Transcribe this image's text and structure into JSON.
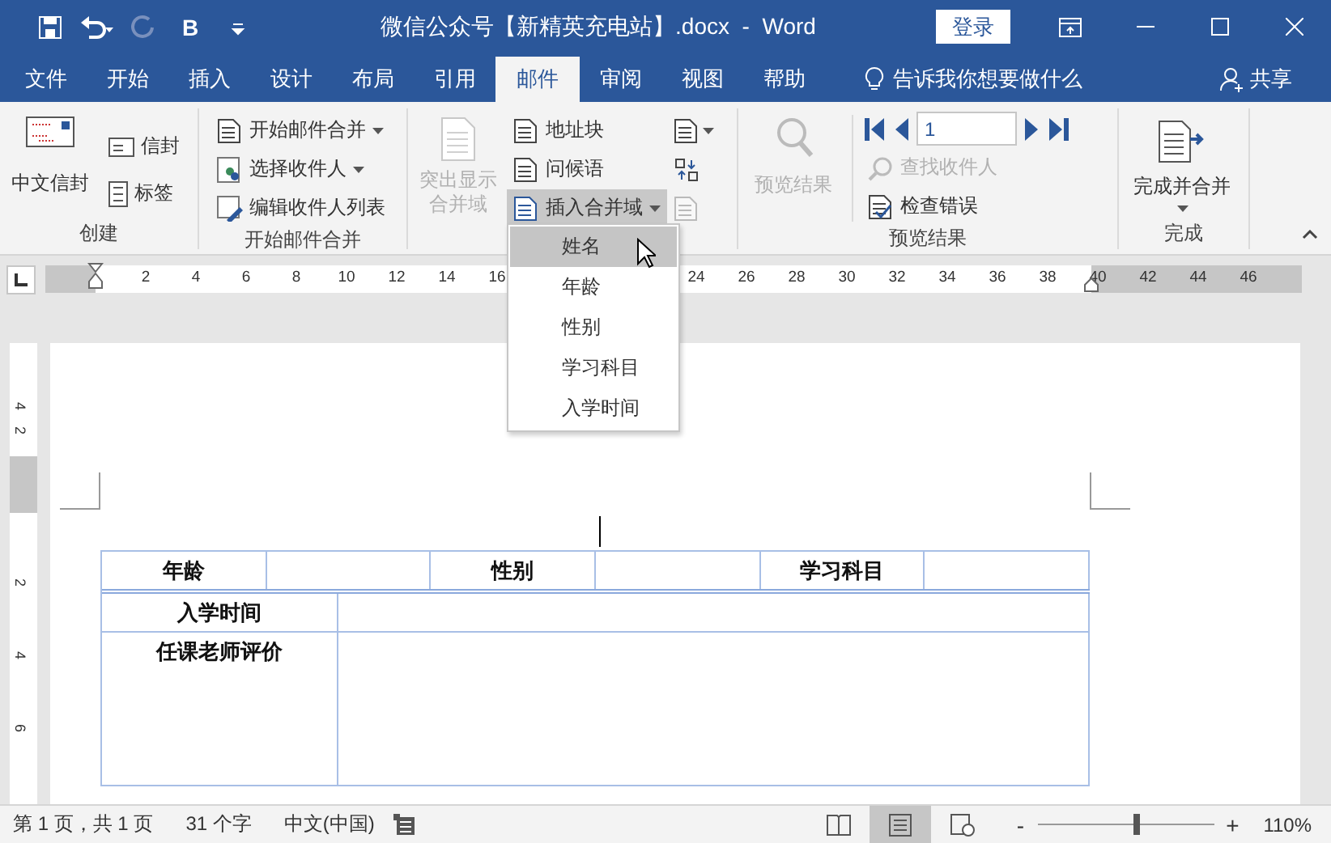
{
  "window": {
    "title": "微信公众号【新精英充电站】.docx  -  Word",
    "login_button": "登录"
  },
  "quick_access": {
    "bold_label": "B",
    "redo_disabled": true
  },
  "tabs": [
    {
      "label": "文件",
      "selected": false
    },
    {
      "label": "开始",
      "selected": false
    },
    {
      "label": "插入",
      "selected": false
    },
    {
      "label": "设计",
      "selected": false
    },
    {
      "label": "布局",
      "selected": false
    },
    {
      "label": "引用",
      "selected": false
    },
    {
      "label": "邮件",
      "selected": true
    },
    {
      "label": "审阅",
      "selected": false
    },
    {
      "label": "视图",
      "selected": false
    },
    {
      "label": "帮助",
      "selected": false
    }
  ],
  "tell_me": "告诉我你想要做什么",
  "share": "共享",
  "ribbon": {
    "create": {
      "chinese_envelope": "中文信封",
      "envelopes": "信封",
      "labels": "标签",
      "group_label": "创建"
    },
    "start": {
      "start_mail_merge": "开始邮件合并",
      "select_recipients": "选择收件人",
      "edit_recipient_list": "编辑收件人列表",
      "group_label": "开始邮件合并"
    },
    "write": {
      "highlight_merge_fields": {
        "label": "突出显示合并域",
        "disabled": true
      },
      "address_block": "地址块",
      "greeting_line": "问候语",
      "insert_merge_field": {
        "label": "插入合并域",
        "pressed": true
      },
      "update_labels": {
        "disabled": true
      }
    },
    "preview": {
      "preview_results": {
        "label": "预览结果",
        "disabled": true
      },
      "record": "1",
      "find_recipient": {
        "label": "查找收件人",
        "disabled": true
      },
      "check_errors": "检查错误",
      "group_label": "预览结果"
    },
    "finish": {
      "finish_merge": "完成并合并",
      "group_label": "完成"
    }
  },
  "ruler": {
    "numbers_before_menu": [
      "2",
      "4",
      "6",
      "8",
      "10",
      "12",
      "14",
      "16"
    ],
    "numbers_after_menu": [
      "24",
      "26",
      "28",
      "30",
      "32",
      "34",
      "36",
      "38",
      "40",
      "42",
      "44",
      "46"
    ]
  },
  "vertical_ruler": {
    "numbers_above": [
      "4",
      "2"
    ],
    "numbers_below": [
      "2",
      "4",
      "6"
    ]
  },
  "table": {
    "header_row": [
      "年龄",
      "性别",
      "学习科目"
    ],
    "rows": [
      "入学时间",
      "任课老师评价"
    ]
  },
  "merge_field_menu": {
    "items": [
      {
        "label": "姓名",
        "selected": true
      },
      {
        "label": "年龄",
        "selected": false
      },
      {
        "label": "性别",
        "selected": false
      },
      {
        "label": "学习科目",
        "selected": false
      },
      {
        "label": "入学时间",
        "selected": false
      }
    ]
  },
  "status_bar": {
    "page": "第 1 页，共 1 页",
    "words": "31 个字",
    "language": "中文(中国)",
    "views": [
      {
        "kind": "read",
        "selected": false
      },
      {
        "kind": "print",
        "selected": true
      },
      {
        "kind": "web",
        "selected": false
      }
    ],
    "zoom_out": "-",
    "zoom_in": "+",
    "zoom": {
      "level": 0.56,
      "reading": "110%"
    }
  }
}
